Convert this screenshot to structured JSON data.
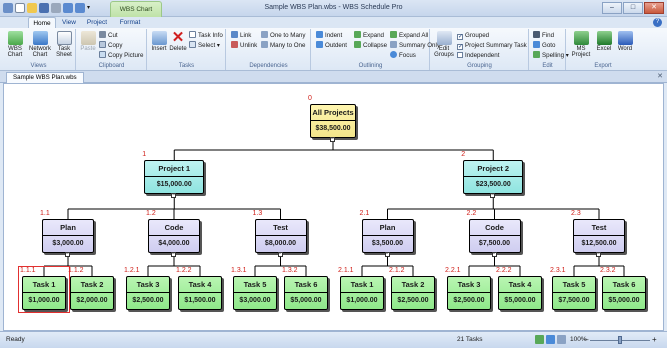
{
  "window": {
    "title": "Sample WBS Plan.wbs - WBS Schedule Pro",
    "context_tab": "WBS Chart",
    "buttons": [
      "–",
      "□",
      "✕"
    ]
  },
  "tabs": [
    "Home",
    "View",
    "Project",
    "Format"
  ],
  "help": "?",
  "ribbon": {
    "views": {
      "label": "Views",
      "wbs_chart": "WBS Chart",
      "network_chart": "Network Chart",
      "task_sheet": "Task Sheet"
    },
    "clipboard": {
      "label": "Clipboard",
      "paste": "Paste",
      "cut": "Cut",
      "copy": "Copy",
      "copy_picture": "Copy Picture"
    },
    "tasks": {
      "label": "Tasks",
      "insert": "Insert",
      "delete": "Delete",
      "task_info": "Task Info",
      "select": "Select"
    },
    "dependencies": {
      "label": "Dependencies",
      "link": "Link",
      "unlink": "Unlink",
      "one_to_many": "One to Many",
      "many_to_one": "Many to One"
    },
    "outlining": {
      "label": "Outlining",
      "indent": "Indent",
      "outdent": "Outdent",
      "expand": "Expand",
      "collapse": "Collapse",
      "expand_all": "Expand All",
      "summary_only": "Summary Only",
      "focus": "Focus"
    },
    "grouping": {
      "label": "Grouping",
      "edit_groups": "Edit Groups",
      "grouped": "Grouped",
      "project_summary_task": "Project Summary Task",
      "independent": "Independent",
      "grouped_checked": true,
      "project_summary_checked": true,
      "independent_checked": false
    },
    "edit": {
      "label": "Edit",
      "find": "Find",
      "goto": "Goto",
      "spelling": "Spelling"
    },
    "export": {
      "label": "Export",
      "ms_project": "MS Project",
      "excel": "Excel",
      "word": "Word"
    }
  },
  "document_tab": "Sample WBS Plan.wbs",
  "wbs": {
    "root": {
      "code": "0",
      "name": "All Projects",
      "cost": "$38,500.00"
    },
    "projects": [
      {
        "code": "1",
        "name": "Project 1",
        "cost": "$15,000.00",
        "phases": [
          {
            "code": "1.1",
            "name": "Plan",
            "cost": "$3,000.00",
            "tasks": [
              {
                "code": "1.1.1",
                "name": "Task 1",
                "cost": "$1,000.00",
                "selected": true
              },
              {
                "code": "1.1.2",
                "name": "Task 2",
                "cost": "$2,000.00"
              }
            ]
          },
          {
            "code": "1.2",
            "name": "Code",
            "cost": "$4,000.00",
            "tasks": [
              {
                "code": "1.2.1",
                "name": "Task 3",
                "cost": "$2,500.00"
              },
              {
                "code": "1.2.2",
                "name": "Task 4",
                "cost": "$1,500.00"
              }
            ]
          },
          {
            "code": "1.3",
            "name": "Test",
            "cost": "$8,000.00",
            "tasks": [
              {
                "code": "1.3.1",
                "name": "Task 5",
                "cost": "$3,000.00"
              },
              {
                "code": "1.3.2",
                "name": "Task 6",
                "cost": "$5,000.00"
              }
            ]
          }
        ]
      },
      {
        "code": "2",
        "name": "Project 2",
        "cost": "$23,500.00",
        "phases": [
          {
            "code": "2.1",
            "name": "Plan",
            "cost": "$3,500.00",
            "tasks": [
              {
                "code": "2.1.1",
                "name": "Task 1",
                "cost": "$1,000.00"
              },
              {
                "code": "2.1.2",
                "name": "Task 2",
                "cost": "$2,500.00"
              }
            ]
          },
          {
            "code": "2.2",
            "name": "Code",
            "cost": "$7,500.00",
            "tasks": [
              {
                "code": "2.2.1",
                "name": "Task 3",
                "cost": "$2,500.00"
              },
              {
                "code": "2.2.2",
                "name": "Task 4",
                "cost": "$5,000.00"
              }
            ]
          },
          {
            "code": "2.3",
            "name": "Test",
            "cost": "$12,500.00",
            "tasks": [
              {
                "code": "2.3.1",
                "name": "Task 5",
                "cost": "$7,500.00"
              },
              {
                "code": "2.3.2",
                "name": "Task 6",
                "cost": "$5,000.00"
              }
            ]
          }
        ]
      }
    ]
  },
  "status": {
    "ready": "Ready",
    "task_count": "21 Tasks",
    "zoom": "100%",
    "zoom_minus": "–",
    "zoom_plus": "+"
  },
  "colors": {
    "root": "#f2e58a",
    "project": "#8fe4e0",
    "phase": "#cfcdf0",
    "task": "#8fe88a",
    "wbs_code": "#d0201a"
  }
}
